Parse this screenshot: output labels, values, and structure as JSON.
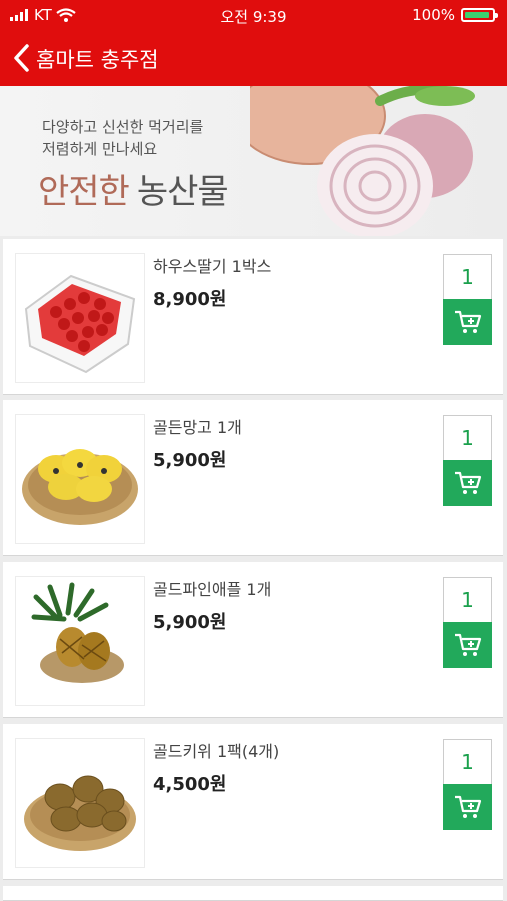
{
  "status_bar": {
    "carrier": "KT",
    "time": "오전 9:39",
    "battery": "100%",
    "battery_level": 1.0
  },
  "nav": {
    "title": "홈마트 충주점"
  },
  "banner": {
    "line1": "다양하고 신선한 먹거리를",
    "line2": "저렴하게 만나세요",
    "highlight": "안전한",
    "title": "농산물"
  },
  "products": [
    {
      "name": "하우스딸기 1박스",
      "price": "8,900원",
      "qty": "1",
      "image": "strawberry"
    },
    {
      "name": "골든망고 1개",
      "price": "5,900원",
      "qty": "1",
      "image": "mango"
    },
    {
      "name": "골드파인애플 1개",
      "price": "5,900원",
      "qty": "1",
      "image": "pineapple"
    },
    {
      "name": "골드키위 1팩(4개)",
      "price": "4,500원",
      "qty": "1",
      "image": "kiwi"
    }
  ],
  "colors": {
    "brand_red": "#e00d0d",
    "cart_green": "#22a95b",
    "qty_green": "#1aa04c"
  }
}
